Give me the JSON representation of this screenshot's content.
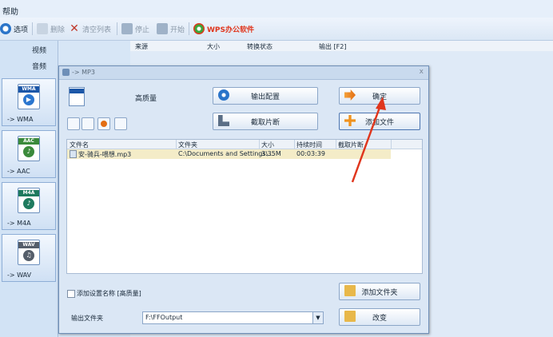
{
  "menu": {
    "help": "帮助"
  },
  "toolbar": {
    "options": "选项",
    "delete": "删除",
    "clear": "清空列表",
    "stop": "停止",
    "start": "开始",
    "wps": "WPS办公软件"
  },
  "sidebar": {
    "video": "视频",
    "audio": "音频",
    "items": [
      {
        "tag": "WMA",
        "label": "-> WMA"
      },
      {
        "tag": "AAC",
        "label": "-> AAC"
      },
      {
        "tag": "M4A",
        "label": "-> M4A"
      },
      {
        "tag": "WAV",
        "label": "-> WAV"
      }
    ]
  },
  "task_list": {
    "columns": [
      "来源",
      "大小",
      "转换状态",
      "输出 [F2]"
    ]
  },
  "dialog": {
    "title": "-> MP3",
    "close": "x",
    "quality": "高质量",
    "output_config": "输出配置",
    "clip": "截取片断",
    "ok": "确定",
    "add_file": "添加文件",
    "add_folder": "添加文件夹",
    "change": "改变",
    "table": {
      "columns": [
        "文件名",
        "文件夹",
        "大小",
        "持续时间",
        "截取片断"
      ],
      "rows": [
        {
          "name": "安-骑兵-喂想.mp3",
          "folder": "C:\\Documents and Settings\\...",
          "size": "3.35M",
          "duration": "00:03:39",
          "clip": ""
        }
      ]
    },
    "checkbox_label": "添加设置名称 [高质量]",
    "output_folder_label": "输出文件夹",
    "output_folder_value": "F:\\FFOutput"
  },
  "colors": {
    "accent": "#1c57a8",
    "arrow": "#e0361d",
    "row_highlight": "#f4ecc8"
  }
}
